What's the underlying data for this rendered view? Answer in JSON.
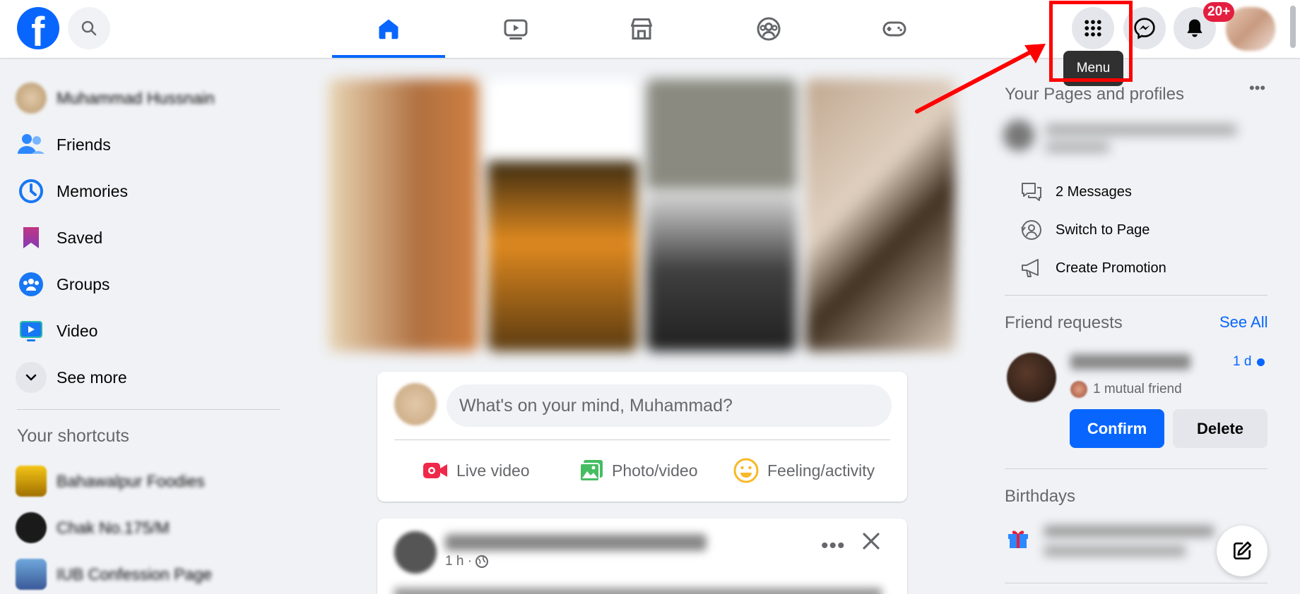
{
  "header": {
    "logo_letter": "f",
    "notifications_badge": "20+",
    "tooltip": "Menu",
    "nav_tabs": [
      "home-tab",
      "video-tab",
      "marketplace-tab",
      "groups-tab",
      "gaming-tab"
    ]
  },
  "sidebar": {
    "profile_name": "Muhammad Hussnain",
    "items": [
      {
        "label": "Friends"
      },
      {
        "label": "Memories"
      },
      {
        "label": "Saved"
      },
      {
        "label": "Groups"
      },
      {
        "label": "Video"
      },
      {
        "label": "See more"
      }
    ],
    "shortcuts_title": "Your shortcuts",
    "shortcuts": [
      {
        "label": "Bahawalpur Foodies"
      },
      {
        "label": "Chak No.175/M"
      },
      {
        "label": "IUB Confession Page"
      }
    ]
  },
  "composer": {
    "placeholder": "What's on your mind, Muhammad?",
    "actions": [
      {
        "label": "Live video"
      },
      {
        "label": "Photo/video"
      },
      {
        "label": "Feeling/activity"
      }
    ]
  },
  "post": {
    "time": "1 h ·"
  },
  "right": {
    "pages_title": "Your Pages and profiles",
    "page_actions": [
      {
        "label": "2 Messages"
      },
      {
        "label": "Switch to Page"
      },
      {
        "label": "Create Promotion"
      }
    ],
    "friend_requests_title": "Friend requests",
    "see_all": "See All",
    "request": {
      "age": "1 d",
      "mutual": "1 mutual friend",
      "confirm": "Confirm",
      "delete": "Delete"
    },
    "birthdays_title": "Birthdays"
  },
  "colors": {
    "brand_blue": "#0866ff",
    "badge_red": "#e41e3f",
    "annotation_red": "#ff0000"
  }
}
